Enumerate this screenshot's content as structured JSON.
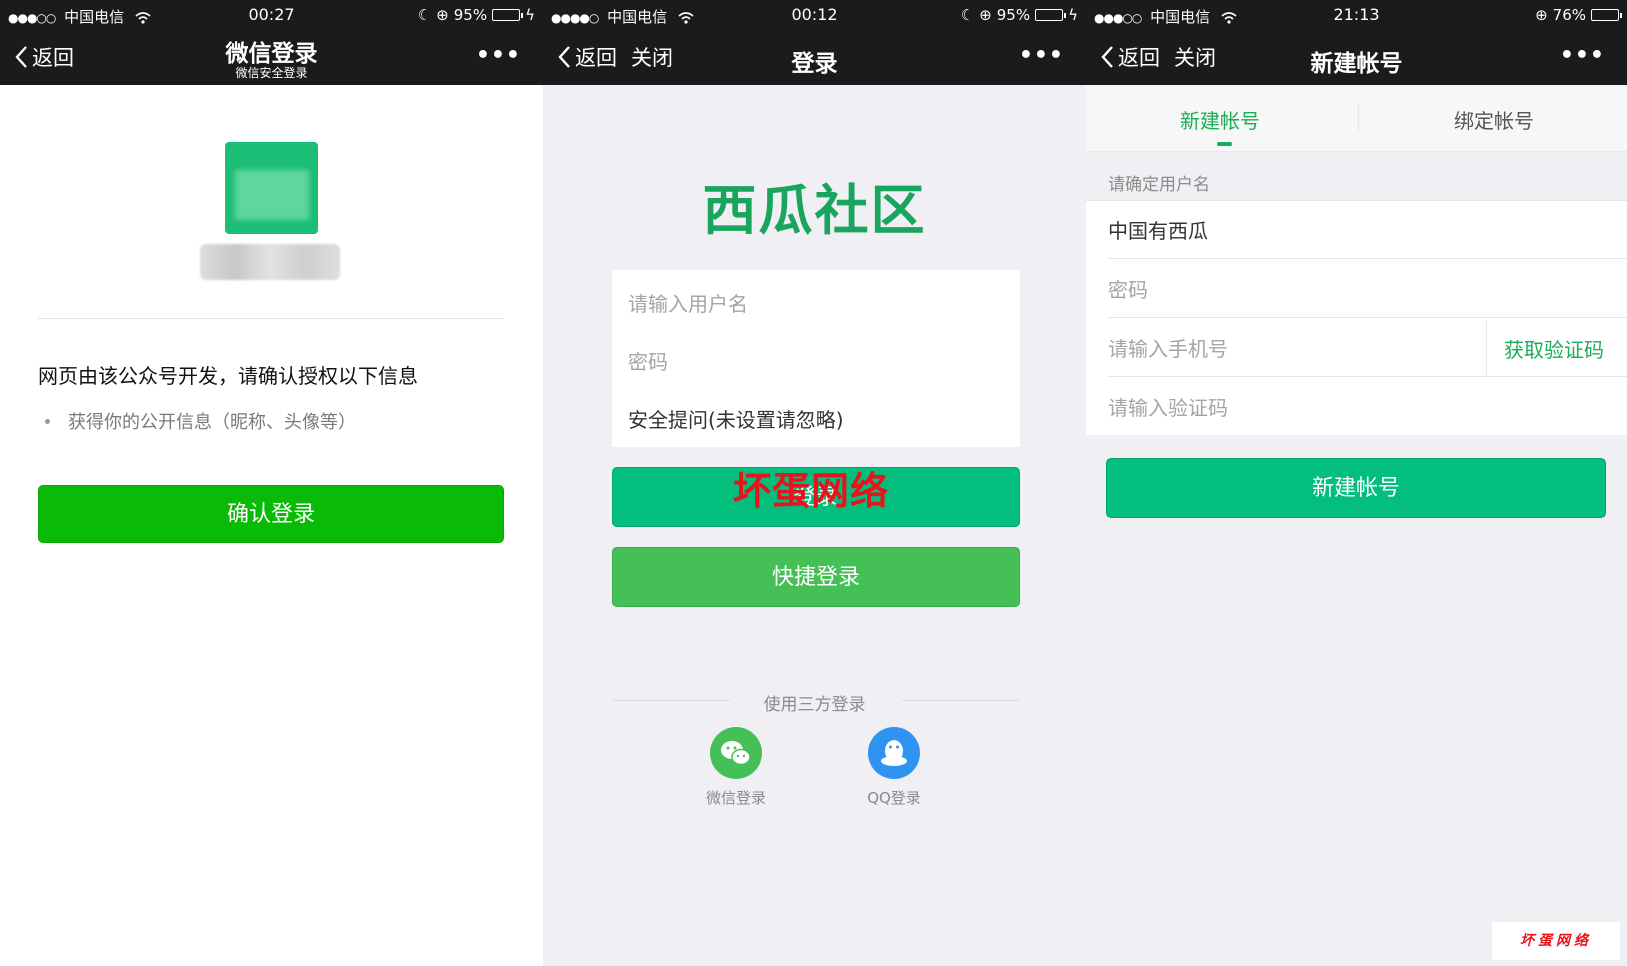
{
  "panels": [
    {
      "status": {
        "carrier": "中国电信",
        "time": "00:27",
        "battery": "95%"
      },
      "nav": {
        "back": "返回",
        "title": "微信登录",
        "subtitle": "微信安全登录"
      },
      "notice": "网页由该公众号开发，请确认授权以下信息",
      "permission": "获得你的公开信息（昵称、头像等）",
      "confirm_button": "确认登录"
    },
    {
      "status": {
        "carrier": "中国电信",
        "time": "00:12",
        "battery": "95%"
      },
      "nav": {
        "back": "返回",
        "close": "关闭",
        "title": "登录"
      },
      "logo": "西瓜社区",
      "username_placeholder": "请输入用户名",
      "password_placeholder": "密码",
      "security_question": "安全提问(未设置请忽略)",
      "login_button": "登录",
      "watermark": "坏蛋网络",
      "quick_login_button": "快捷登录",
      "third_party_label": "使用三方登录",
      "wechat_login": "微信登录",
      "qq_login": "QQ登录"
    },
    {
      "status": {
        "carrier": "中国电信",
        "time": "21:13",
        "battery": "76%"
      },
      "nav": {
        "back": "返回",
        "close": "关闭",
        "title": "新建帐号"
      },
      "tabs": [
        "新建帐号",
        "绑定帐号"
      ],
      "section_label": "请确定用户名",
      "username_value": "中国有西瓜",
      "password_placeholder": "密码",
      "phone_placeholder": "请输入手机号",
      "get_code_button": "获取验证码",
      "code_placeholder": "请输入验证码",
      "create_button": "新建帐号",
      "corner_logo": "坏蛋网络"
    }
  ],
  "colors": {
    "wechat_green": "#09bb07",
    "primary_green": "#04be7e",
    "quick_green": "#44c057",
    "accent_green": "#1aad59",
    "watermark_red": "#e8131b",
    "qq_blue": "#2f93f0"
  },
  "battery_levels": [
    0.95,
    0.95,
    0.76
  ]
}
